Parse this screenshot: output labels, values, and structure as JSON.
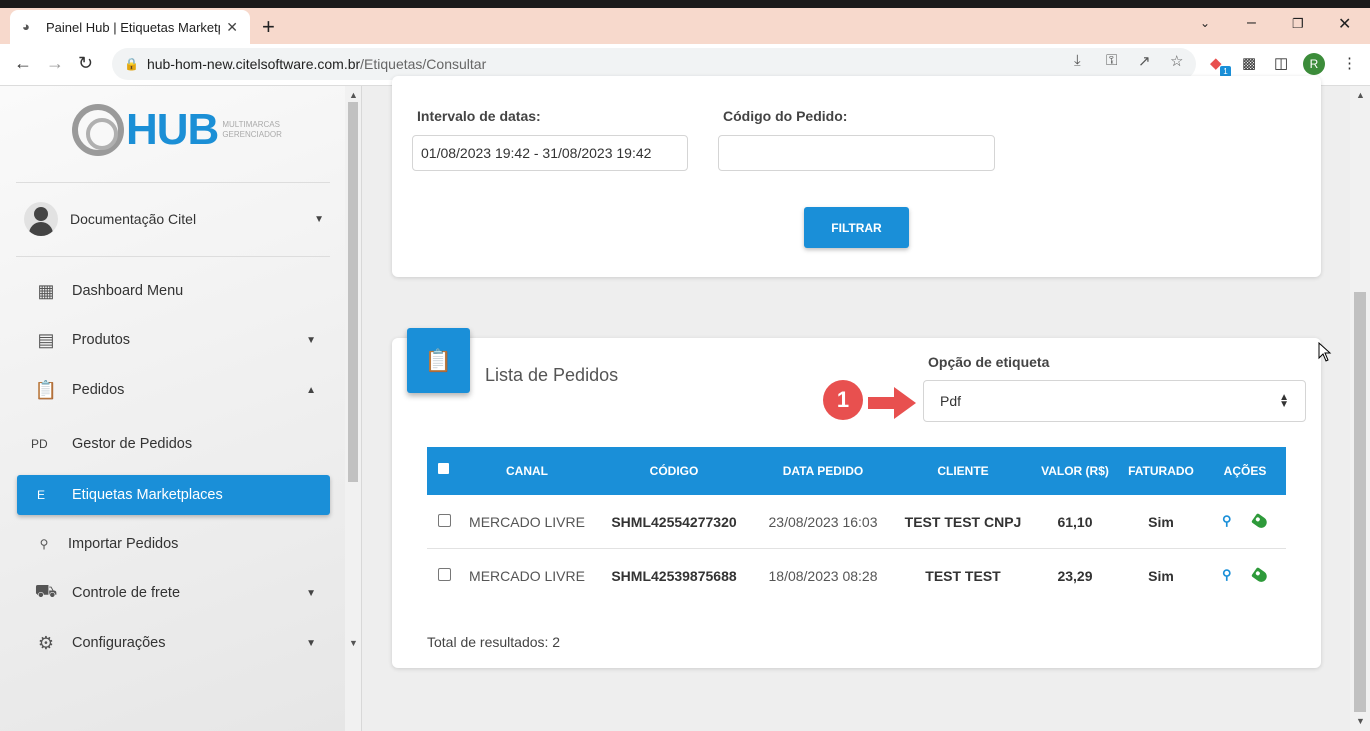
{
  "browser": {
    "tab_title": "Painel Hub | Etiquetas Marketplac",
    "url_host": "hub-hom-new.citelsoftware.com.br",
    "url_path": "/Etiquetas/Consultar",
    "profile_initial": "R",
    "ext_badge": "1"
  },
  "sidebar": {
    "logo_text": "HUB",
    "logo_sub": "MULTIMARCAS GERENCIADOR",
    "user_name": "Documentação Citel",
    "items": [
      {
        "label": "Dashboard Menu"
      },
      {
        "label": "Produtos"
      },
      {
        "label": "Pedidos"
      },
      {
        "abbr": "PD",
        "label": "Gestor de Pedidos"
      },
      {
        "abbr": "E",
        "label": "Etiquetas Marketplaces"
      },
      {
        "label": "Importar Pedidos"
      },
      {
        "label": "Controle de frete"
      },
      {
        "label": "Configurações"
      }
    ]
  },
  "filter": {
    "date_label": "Intervalo de datas:",
    "date_value": "01/08/2023 19:42 - 31/08/2023 19:42",
    "code_label": "Código do Pedido:",
    "code_value": "",
    "filter_button": "FILTRAR"
  },
  "orders": {
    "title": "Lista de Pedidos",
    "option_label": "Opção de etiqueta",
    "option_value": "Pdf",
    "annotation_number": "1",
    "columns": [
      "CANAL",
      "CÓDIGO",
      "DATA PEDIDO",
      "CLIENTE",
      "VALOR (R$)",
      "FATURADO",
      "AÇÕES"
    ],
    "rows": [
      {
        "canal": "MERCADO LIVRE",
        "codigo": "SHML42554277320",
        "data": "23/08/2023 16:03",
        "cliente": "TEST TEST CNPJ",
        "valor": "61,10",
        "faturado": "Sim"
      },
      {
        "canal": "MERCADO LIVRE",
        "codigo": "SHML42539875688",
        "data": "18/08/2023 08:28",
        "cliente": "TEST TEST",
        "valor": "23,29",
        "faturado": "Sim"
      }
    ],
    "total_text": "Total de resultados: 2"
  },
  "colors": {
    "accent": "#1a8fd8",
    "annotation": "#e8504f",
    "tag_green": "#2e9a3a",
    "tab_strip": "#f7d9cc"
  }
}
